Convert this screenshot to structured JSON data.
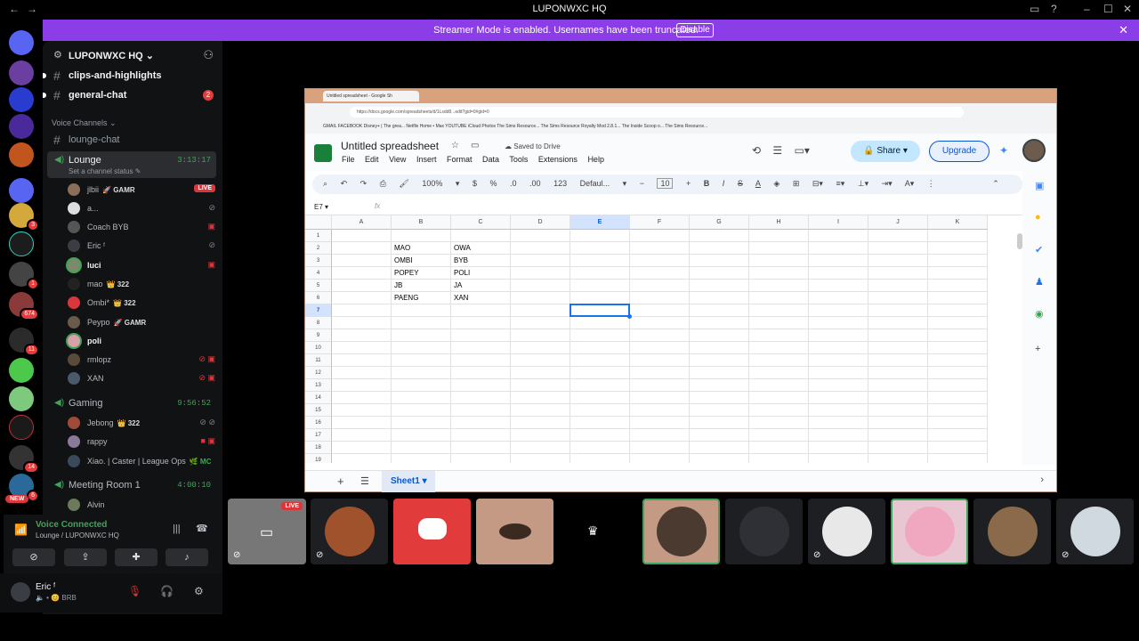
{
  "window": {
    "title": "LUPONWXC HQ",
    "back_icon": "←",
    "forward_icon": "→"
  },
  "banner": {
    "message": "Streamer Mode is enabled. Usernames have been truncated.",
    "disable_label": "Disable"
  },
  "rail": {
    "badges": [
      "3",
      "1",
      "674",
      "11",
      "14",
      "6"
    ],
    "new_label": "NEW"
  },
  "server": {
    "name": "LUPONWXC HQ ⌄"
  },
  "text_channels": [
    {
      "name": "clips-and-highlights"
    },
    {
      "name": "general-chat",
      "count": "2"
    }
  ],
  "voice_category": "Voice Channels ⌄",
  "lounge_chat": "lounge-chat",
  "lounge": {
    "name": "Lounge",
    "time": "3:13:17",
    "status": "Set a channel status ✎"
  },
  "lounge_members": [
    {
      "name": "jlbii",
      "tag": "🚀 GAMR",
      "live": "LIVE"
    },
    {
      "name": "a...",
      "icons": "⊘"
    },
    {
      "name": "Coach BYB",
      "icons": "▣"
    },
    {
      "name": "Eric ᶠ",
      "icons": "⊘"
    },
    {
      "name": "luci",
      "bold": true,
      "icons": "▣"
    },
    {
      "name": "mao",
      "tag": "👑 322"
    },
    {
      "name": "Ombi*",
      "tag": "👑 322"
    },
    {
      "name": "Peypo",
      "tag": "🚀 GAMR"
    },
    {
      "name": "poli",
      "bold": true
    },
    {
      "name": "rmlopz",
      "icons": "⊘ ▣"
    },
    {
      "name": "XAN",
      "icons": "⊘ ▣"
    }
  ],
  "gaming": {
    "name": "Gaming",
    "time": "9:56:52"
  },
  "gaming_members": [
    {
      "name": "Jebong",
      "tag": "👑 322",
      "icons": "⊘ ⊘"
    },
    {
      "name": "rappy",
      "icons": "■ ▣"
    },
    {
      "name": "Xiao. | Caster | League Ops",
      "tag": "🌿 MC"
    }
  ],
  "meeting": {
    "name": "Meeting Room 1",
    "time": "4:00:10"
  },
  "meeting_members": [
    {
      "name": "Alvin"
    }
  ],
  "voice": {
    "title": "Voice Connected",
    "sub": "Lounge / LUPONWXC HQ"
  },
  "user": {
    "name": "Eric ᶠ",
    "status": "🔈 • 😊 BRB"
  },
  "browser": {
    "tab_title": "Untitled spreadsheet - Google Sh",
    "url": "https://docs.google.com/spreadsheets/d/1Lsdd8...edit?gid=0#gid=0",
    "bookmarks": "GMAIL   FACEBOOK   Disney+ | The grea...   Netflix   Home • Max   YOUTUBE   iCloud Photos   The Sims Resource...   The Sims Resource   Royalty Mod 2.8.1...   The Inside Scoop o...   The Sims Resource..."
  },
  "sheet": {
    "title": "Untitled spreadsheet",
    "saved": "Saved to Drive",
    "menu": [
      "File",
      "Edit",
      "View",
      "Insert",
      "Format",
      "Data",
      "Tools",
      "Extensions",
      "Help"
    ],
    "share": "Share",
    "upgrade": "Upgrade",
    "zoom": "100%",
    "font": "Defaul...",
    "font_size": "10",
    "cell_ref": "E7",
    "fx": "fx",
    "columns": [
      "A",
      "B",
      "C",
      "D",
      "E",
      "F",
      "G",
      "H",
      "I",
      "J",
      "K"
    ],
    "rows": [
      "1",
      "2",
      "3",
      "4",
      "5",
      "6",
      "7",
      "8",
      "9",
      "10",
      "11",
      "12",
      "13",
      "14",
      "15",
      "16",
      "17",
      "18",
      "19"
    ],
    "cells": [
      {
        "col": "B",
        "row": 2,
        "value": "MAO"
      },
      {
        "col": "C",
        "row": 2,
        "value": "OWA"
      },
      {
        "col": "B",
        "row": 3,
        "value": "OMBI"
      },
      {
        "col": "C",
        "row": 3,
        "value": "BYB"
      },
      {
        "col": "B",
        "row": 4,
        "value": "POPEY"
      },
      {
        "col": "C",
        "row": 4,
        "value": "POLI"
      },
      {
        "col": "B",
        "row": 5,
        "value": "JB"
      },
      {
        "col": "C",
        "row": 5,
        "value": "JA"
      },
      {
        "col": "B",
        "row": 6,
        "value": "PAENG"
      },
      {
        "col": "C",
        "row": 6,
        "value": "XAN"
      }
    ],
    "tab": "Sheet1"
  },
  "tiles": {
    "live": "LIVE"
  }
}
